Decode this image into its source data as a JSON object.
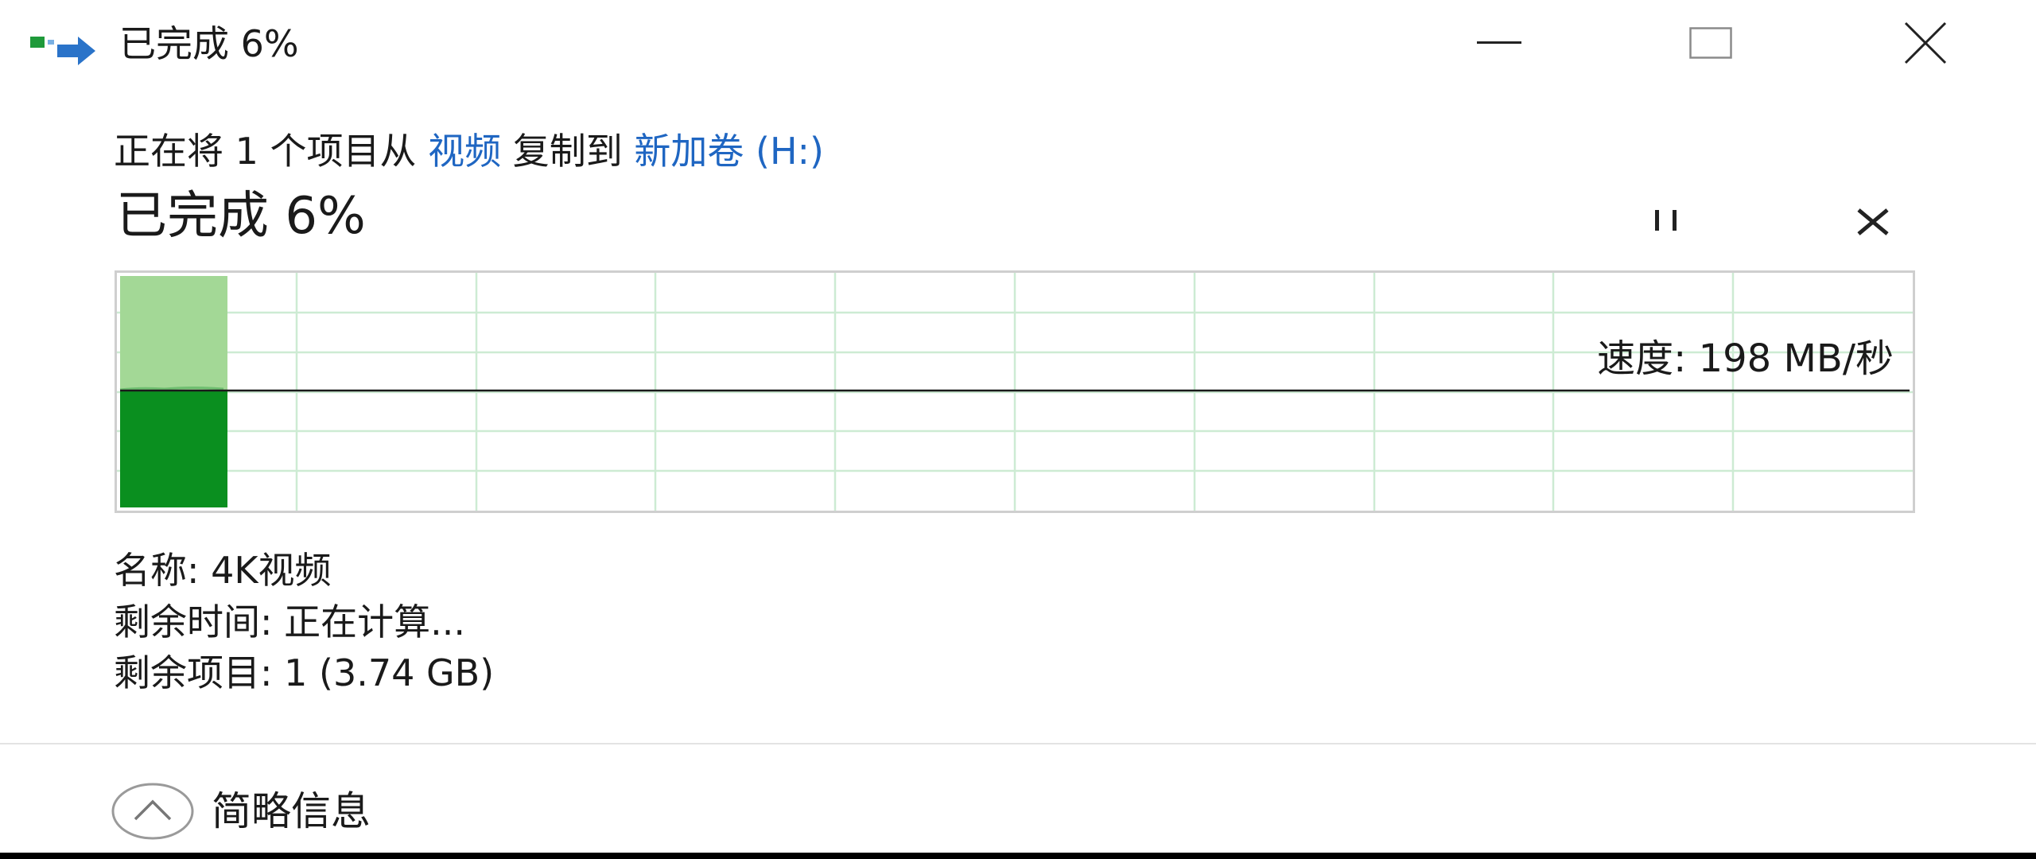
{
  "window": {
    "title": "已完成 6%",
    "icon": "file-copy-icon",
    "buttons": {
      "minimize": "minimize-icon",
      "maximize": "maximize-icon",
      "close": "close-icon"
    }
  },
  "copy_status": {
    "prefix": "正在将 1 个项目从 ",
    "source": "视频",
    "middle": " 复制到 ",
    "destination": "新加卷 (H:)"
  },
  "progress": {
    "title": "已完成 6%",
    "percent": 6,
    "pause_icon": "pause-icon",
    "cancel_icon": "cancel-icon"
  },
  "graph": {
    "speed_label": "速度: 198 MB/秒",
    "fill_color": "#a3d896",
    "current_color": "#0a8f1f",
    "grid_color": "#cdebd3"
  },
  "details": {
    "name": "名称: 4K视频",
    "time_remaining": "剩余时间: 正在计算...",
    "items_remaining": "剩余项目: 1 (3.74 GB)"
  },
  "footer": {
    "toggle_label": "简略信息",
    "toggle_icon": "chevron-up-icon"
  }
}
